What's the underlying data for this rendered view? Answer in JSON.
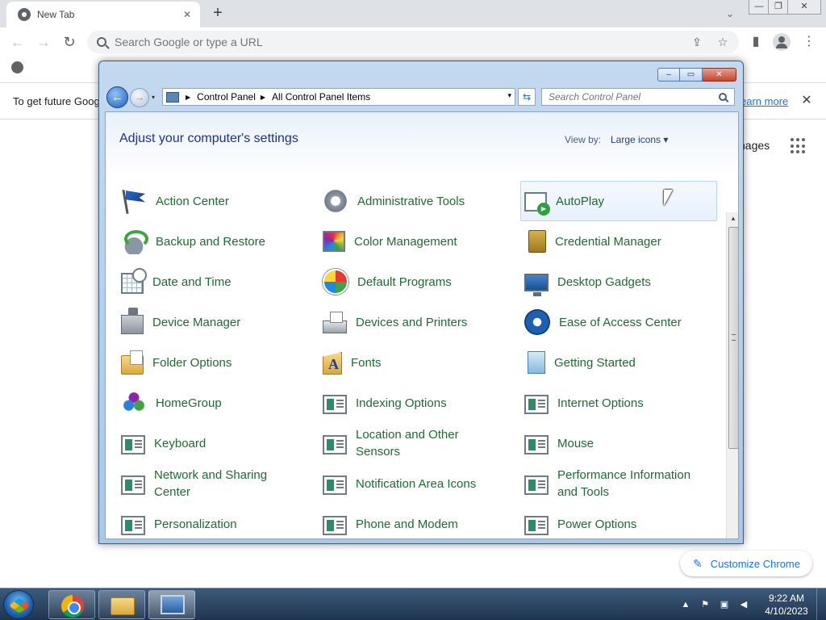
{
  "browser": {
    "tab_title": "New Tab",
    "tab_close_glyph": "✕",
    "new_tab_glyph": "+",
    "tab_search_glyph": "⌄",
    "window_controls": {
      "minimize": "—",
      "restore": "❐",
      "close": "✕"
    },
    "nav": {
      "back_glyph": "←",
      "forward_glyph": "→",
      "reload_glyph": "↻"
    },
    "omnibox_placeholder": "Search Google or type a URL",
    "omnibox_share_glyph": "⇪",
    "omnibox_star_glyph": "☆",
    "side_panel_glyph": "▮",
    "menu_glyph": "⋮",
    "infobar_text": "To get future Goog",
    "infobar_link": "earn more",
    "infobar_close_glyph": "✕",
    "google_images_partial": "nages",
    "customize_chrome_label": "Customize Chrome",
    "customize_chrome_glyph": "✎"
  },
  "control_panel": {
    "caption_buttons": {
      "minimize": "–",
      "maximize": "▭",
      "close": "✕"
    },
    "back_glyph": "←",
    "forward_glyph": "→",
    "recent_glyph": "▾",
    "breadcrumbs": [
      "Control Panel",
      "All Control Panel Items"
    ],
    "crumb_sep_glyph": "▶",
    "address_drop_glyph": "▾",
    "refresh_glyph": "⇆",
    "search_placeholder": "Search Control Panel",
    "heading": "Adjust your computer's settings",
    "view_by_label": "View by:",
    "view_by_value": "Large icons",
    "scroll_up_glyph": "▲",
    "scroll_down_glyph": "▼",
    "items": [
      {
        "label": "Action Center",
        "icon": "action-center-icon"
      },
      {
        "label": "Administrative Tools",
        "icon": "administrative-tools-icon"
      },
      {
        "label": "AutoPlay",
        "icon": "autoplay-icon"
      },
      {
        "label": "Backup and Restore",
        "icon": "backup-restore-icon"
      },
      {
        "label": "Color Management",
        "icon": "color-management-icon"
      },
      {
        "label": "Credential Manager",
        "icon": "credential-manager-icon"
      },
      {
        "label": "Date and Time",
        "icon": "date-time-icon"
      },
      {
        "label": "Default Programs",
        "icon": "default-programs-icon"
      },
      {
        "label": "Desktop Gadgets",
        "icon": "desktop-gadgets-icon"
      },
      {
        "label": "Device Manager",
        "icon": "device-manager-icon"
      },
      {
        "label": "Devices and Printers",
        "icon": "devices-printers-icon"
      },
      {
        "label": "Ease of Access Center",
        "icon": "ease-of-access-icon"
      },
      {
        "label": "Folder Options",
        "icon": "folder-options-icon"
      },
      {
        "label": "Fonts",
        "icon": "fonts-icon"
      },
      {
        "label": "Getting Started",
        "icon": "getting-started-icon"
      },
      {
        "label": "HomeGroup",
        "icon": "homegroup-icon"
      },
      {
        "label": "Indexing Options",
        "icon": "indexing-options-icon"
      },
      {
        "label": "Internet Options",
        "icon": "internet-options-icon"
      },
      {
        "label": "Keyboard",
        "icon": "keyboard-icon"
      },
      {
        "label": "Location and Other Sensors",
        "icon": "location-sensors-icon"
      },
      {
        "label": "Mouse",
        "icon": "mouse-icon"
      },
      {
        "label": "Network and Sharing Center",
        "icon": "network-sharing-icon"
      },
      {
        "label": "Notification Area Icons",
        "icon": "notification-area-icon"
      },
      {
        "label": "Performance Information and Tools",
        "icon": "performance-info-icon"
      },
      {
        "label": "Personalization",
        "icon": "personalization-icon"
      },
      {
        "label": "Phone and Modem",
        "icon": "phone-modem-icon"
      },
      {
        "label": "Power Options",
        "icon": "power-options-icon"
      }
    ]
  },
  "taskbar": {
    "tray_icons": {
      "expand": "▲",
      "action_center": "⚑",
      "network": "▣",
      "volume": "◀"
    },
    "clock_time": "9:22 AM",
    "clock_date": "4/10/2023"
  },
  "colors": {
    "cp_link_green": "#1e6b2f",
    "cp_heading_blue": "#1e3287",
    "chrome_blue": "#1a73e8",
    "taskbar_top": "#3d5a7a"
  }
}
